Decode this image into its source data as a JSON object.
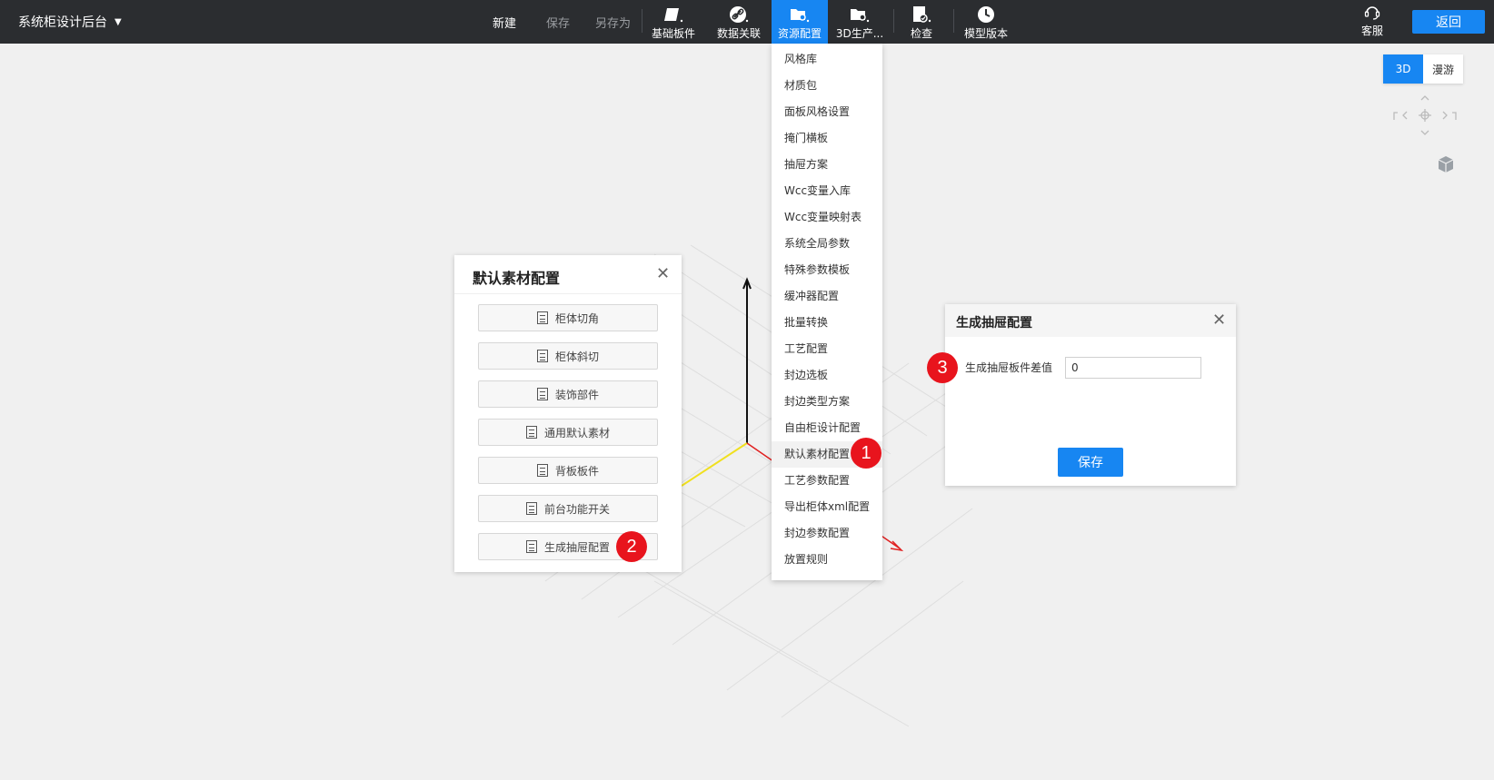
{
  "app": {
    "title": "系统柜设计后台"
  },
  "toolbar": {
    "new_label": "新建",
    "save_label": "保存",
    "save_as_label": "另存为",
    "tools": [
      {
        "label": "基础板件",
        "icon": "panel-icon"
      },
      {
        "label": "数据关联",
        "icon": "link-icon"
      },
      {
        "label": "资源配置",
        "icon": "folder-gear-icon",
        "active": true
      },
      {
        "label": "3D生产...",
        "icon": "folder-gear-icon"
      },
      {
        "label": "检查",
        "icon": "check-doc-icon"
      },
      {
        "label": "模型版本",
        "icon": "clock-icon"
      }
    ],
    "service_label": "客服",
    "back_label": "返回"
  },
  "view_toggle": {
    "mode_3d": "3D",
    "mode_tour": "漫游",
    "selected": "3D"
  },
  "resource_menu": {
    "items": [
      "风格库",
      "材质包",
      "面板风格设置",
      "掩门横板",
      "抽屉方案",
      "Wcc变量入库",
      "Wcc变量映射表",
      "系统全局参数",
      "特殊参数模板",
      "缓冲器配置",
      "批量转换",
      "工艺配置",
      "封边选板",
      "封边类型方案",
      "自由柜设计配置",
      "默认素材配置",
      "工艺参数配置",
      "导出柜体xml配置",
      "封边参数配置",
      "放置规则"
    ],
    "highlighted": "默认素材配置"
  },
  "default_material_panel": {
    "title": "默认素材配置",
    "buttons": [
      "柜体切角",
      "柜体斜切",
      "装饰部件",
      "通用默认素材",
      "背板板件",
      "前台功能开关",
      "生成抽屉配置"
    ]
  },
  "drawer_config_panel": {
    "title": "生成抽屉配置",
    "field_label": "生成抽屉板件差值",
    "field_value": "0",
    "save_label": "保存"
  },
  "step_badges": {
    "one": "1",
    "two": "2",
    "three": "3"
  },
  "colors": {
    "accent": "#1786f2",
    "topbar": "#2b2d30",
    "badge": "#e8141d"
  }
}
